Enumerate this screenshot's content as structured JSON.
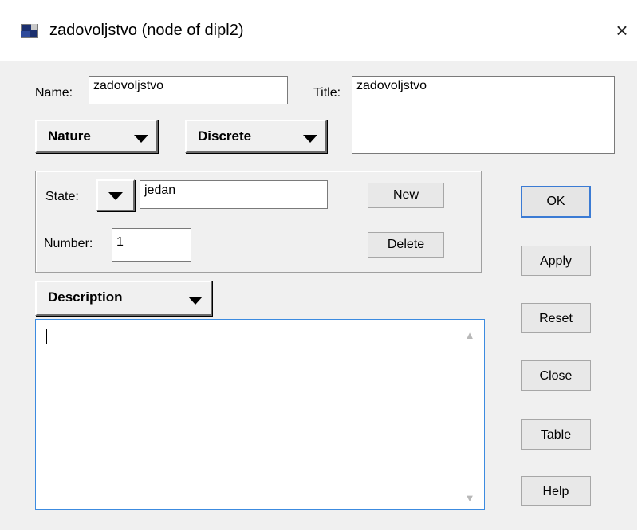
{
  "window": {
    "title": "zadovoljstvo (node of dipl2)",
    "close_label": "×"
  },
  "name": {
    "label": "Name:",
    "value": "zadovoljstvo"
  },
  "title_field": {
    "label": "Title:",
    "value": "zadovoljstvo"
  },
  "nature_dropdown": {
    "label": "Nature"
  },
  "discrete_dropdown": {
    "label": "Discrete"
  },
  "state": {
    "label": "State:",
    "value": "jedan",
    "new_label": "New",
    "delete_label": "Delete"
  },
  "number": {
    "label": "Number:",
    "value": "1"
  },
  "description_dropdown": {
    "label": "Description"
  },
  "description_text": {
    "value": ""
  },
  "buttons": {
    "ok": "OK",
    "apply": "Apply",
    "reset": "Reset",
    "close": "Close",
    "table": "Table",
    "help": "Help"
  },
  "colors": {
    "focus_border": "#3c8be0",
    "dialog_bg": "#f0f0f0"
  },
  "icons": {
    "app": "node-window-icon",
    "close": "close-icon",
    "dropdown": "triangle-down-icon"
  }
}
